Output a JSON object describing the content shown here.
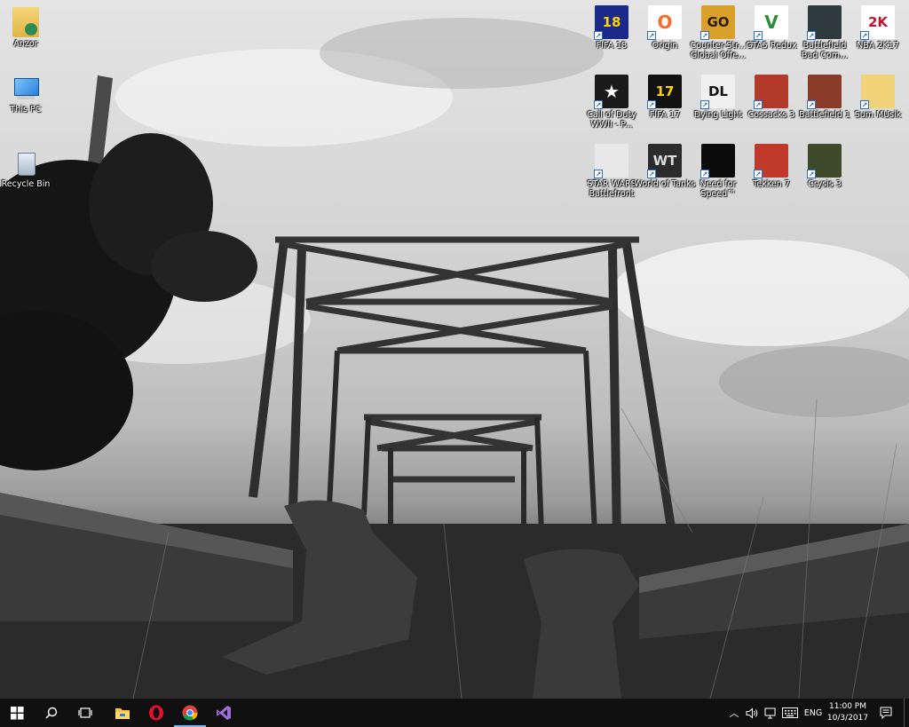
{
  "desktop": {
    "left_icons": [
      {
        "label": "Anzor",
        "icon": "user-folder-icon"
      },
      {
        "label": "This PC",
        "icon": "computer-icon"
      },
      {
        "label": "Recycle Bin",
        "icon": "recycle-bin-icon"
      }
    ],
    "grid_icons": [
      {
        "label": "FIFA 18",
        "icon": "fifa18-icon",
        "glyph": "18",
        "bg": "#1b2a8a",
        "fg": "#ffd400"
      },
      {
        "label": "Origin",
        "icon": "origin-icon",
        "glyph": "O",
        "bg": "#ffffff",
        "fg": "#f56c2d"
      },
      {
        "label": "Counter-Str... Global Offe...",
        "icon": "csgo-icon",
        "glyph": "GO",
        "bg": "#d9a02a",
        "fg": "#2a1d0a"
      },
      {
        "label": "GTA5 Redux",
        "icon": "gta5-icon",
        "glyph": "V",
        "bg": "#ffffff",
        "fg": "#2e8b3a"
      },
      {
        "label": "Battlefield Bad Com...",
        "icon": "battlefield-bad-company-icon",
        "glyph": "",
        "bg": "#2f3a3f",
        "fg": "#ffffff"
      },
      {
        "label": "NBA 2K17",
        "icon": "nba2k17-icon",
        "glyph": "2K",
        "bg": "#ffffff",
        "fg": "#c8102e"
      },
      {
        "label": "Call of Duty WWII - P...",
        "icon": "call-of-duty-icon",
        "glyph": "★",
        "bg": "#1a1a1a",
        "fg": "#ffffff"
      },
      {
        "label": "FIFA 17",
        "icon": "fifa17-icon",
        "glyph": "17",
        "bg": "#111111",
        "fg": "#ffd400"
      },
      {
        "label": "Dying Light",
        "icon": "dying-light-icon",
        "glyph": "DL",
        "bg": "#f0f0f0",
        "fg": "#111111"
      },
      {
        "label": "Cossacks 3",
        "icon": "cossacks3-icon",
        "glyph": "",
        "bg": "#b33a2a",
        "fg": "#ffffff"
      },
      {
        "label": "Battlefield 1",
        "icon": "battlefield1-icon",
        "glyph": "",
        "bg": "#8a3b2a",
        "fg": "#ffffff"
      },
      {
        "label": "Sum MUsik",
        "icon": "music-folder-icon",
        "glyph": "",
        "bg": "#f1d37a",
        "fg": "#3a7bd5"
      },
      {
        "label": "STAR WARS Battlefront",
        "icon": "star-wars-battlefront-icon",
        "glyph": "",
        "bg": "#e8e8e8",
        "fg": "#111111"
      },
      {
        "label": "World of Tanks",
        "icon": "world-of-tanks-icon",
        "glyph": "WT",
        "bg": "#2b2b2b",
        "fg": "#dddddd"
      },
      {
        "label": "Need for Speed™",
        "icon": "need-for-speed-icon",
        "glyph": "",
        "bg": "#0b0b0b",
        "fg": "#ffffff"
      },
      {
        "label": "Tekken 7",
        "icon": "tekken7-icon",
        "glyph": "",
        "bg": "#c0392b",
        "fg": "#ffffff"
      },
      {
        "label": "Crysis 3",
        "icon": "crysis3-icon",
        "glyph": "",
        "bg": "#3e4a2a",
        "fg": "#ffffff"
      }
    ]
  },
  "taskbar": {
    "pinned": [
      {
        "name": "start-button",
        "icon": "windows-logo-icon"
      },
      {
        "name": "search-button",
        "icon": "search-icon"
      },
      {
        "name": "task-view-button",
        "icon": "task-view-icon"
      },
      {
        "name": "file-explorer-button",
        "icon": "folder-icon"
      },
      {
        "name": "opera-button",
        "icon": "opera-icon"
      },
      {
        "name": "chrome-button",
        "icon": "chrome-icon"
      },
      {
        "name": "visual-studio-button",
        "icon": "visual-studio-icon"
      }
    ],
    "tray": {
      "language": "ENG",
      "time": "11:00 PM",
      "date": "10/3/2017"
    }
  },
  "colors": {
    "taskbar_bg": "#101010",
    "active_underline": "#76b9ed",
    "shortcut_arrow": "#2b6cc4"
  }
}
